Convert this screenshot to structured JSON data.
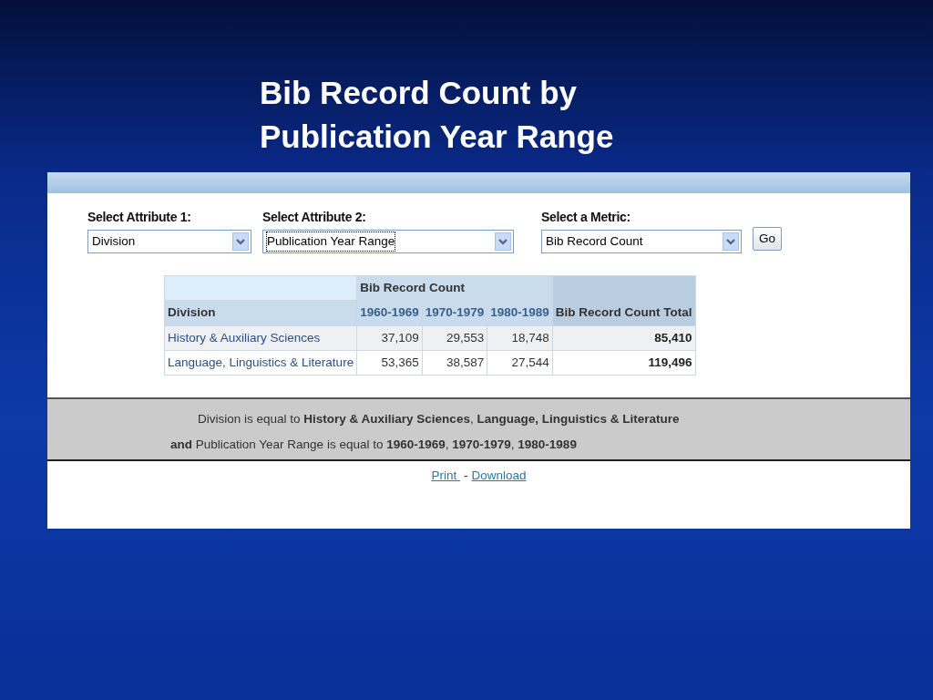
{
  "slide_title": [
    "Bib Record Count by",
    "Publication Year Range"
  ],
  "selectors": [
    {
      "label": "Select Attribute 1:",
      "value": "Division",
      "focused": false
    },
    {
      "label": "Select Attribute 2:",
      "value": "Publication Year Range",
      "focused": true
    },
    {
      "label": "Select a Metric:",
      "value": "Bib Record Count",
      "focused": false
    }
  ],
  "go_button": "Go",
  "table": {
    "row_header": "Division",
    "group_header": "Bib Record Count",
    "columns": [
      "1960-1969",
      "1970-1979",
      "1980-1989"
    ],
    "total_header": "Bib Record Count Total",
    "rows": [
      {
        "name": "History & Auxiliary Sciences",
        "values": [
          "37,109",
          "29,553",
          "18,748"
        ],
        "total": "85,410"
      },
      {
        "name": "Language, Linguistics & Literature",
        "values": [
          "53,365",
          "38,587",
          "27,544"
        ],
        "total": "119,496"
      }
    ]
  },
  "filter_lines": [
    "Division is equal to **History & Auxiliary Sciences**, **Language, Linguistics & Literature**",
    "**and** Publication Year Range is equal to **1960-1969**, **1970-1979**, **1980-1989**"
  ],
  "links": [
    "Print ",
    "Download"
  ],
  "link_separator": "-"
}
